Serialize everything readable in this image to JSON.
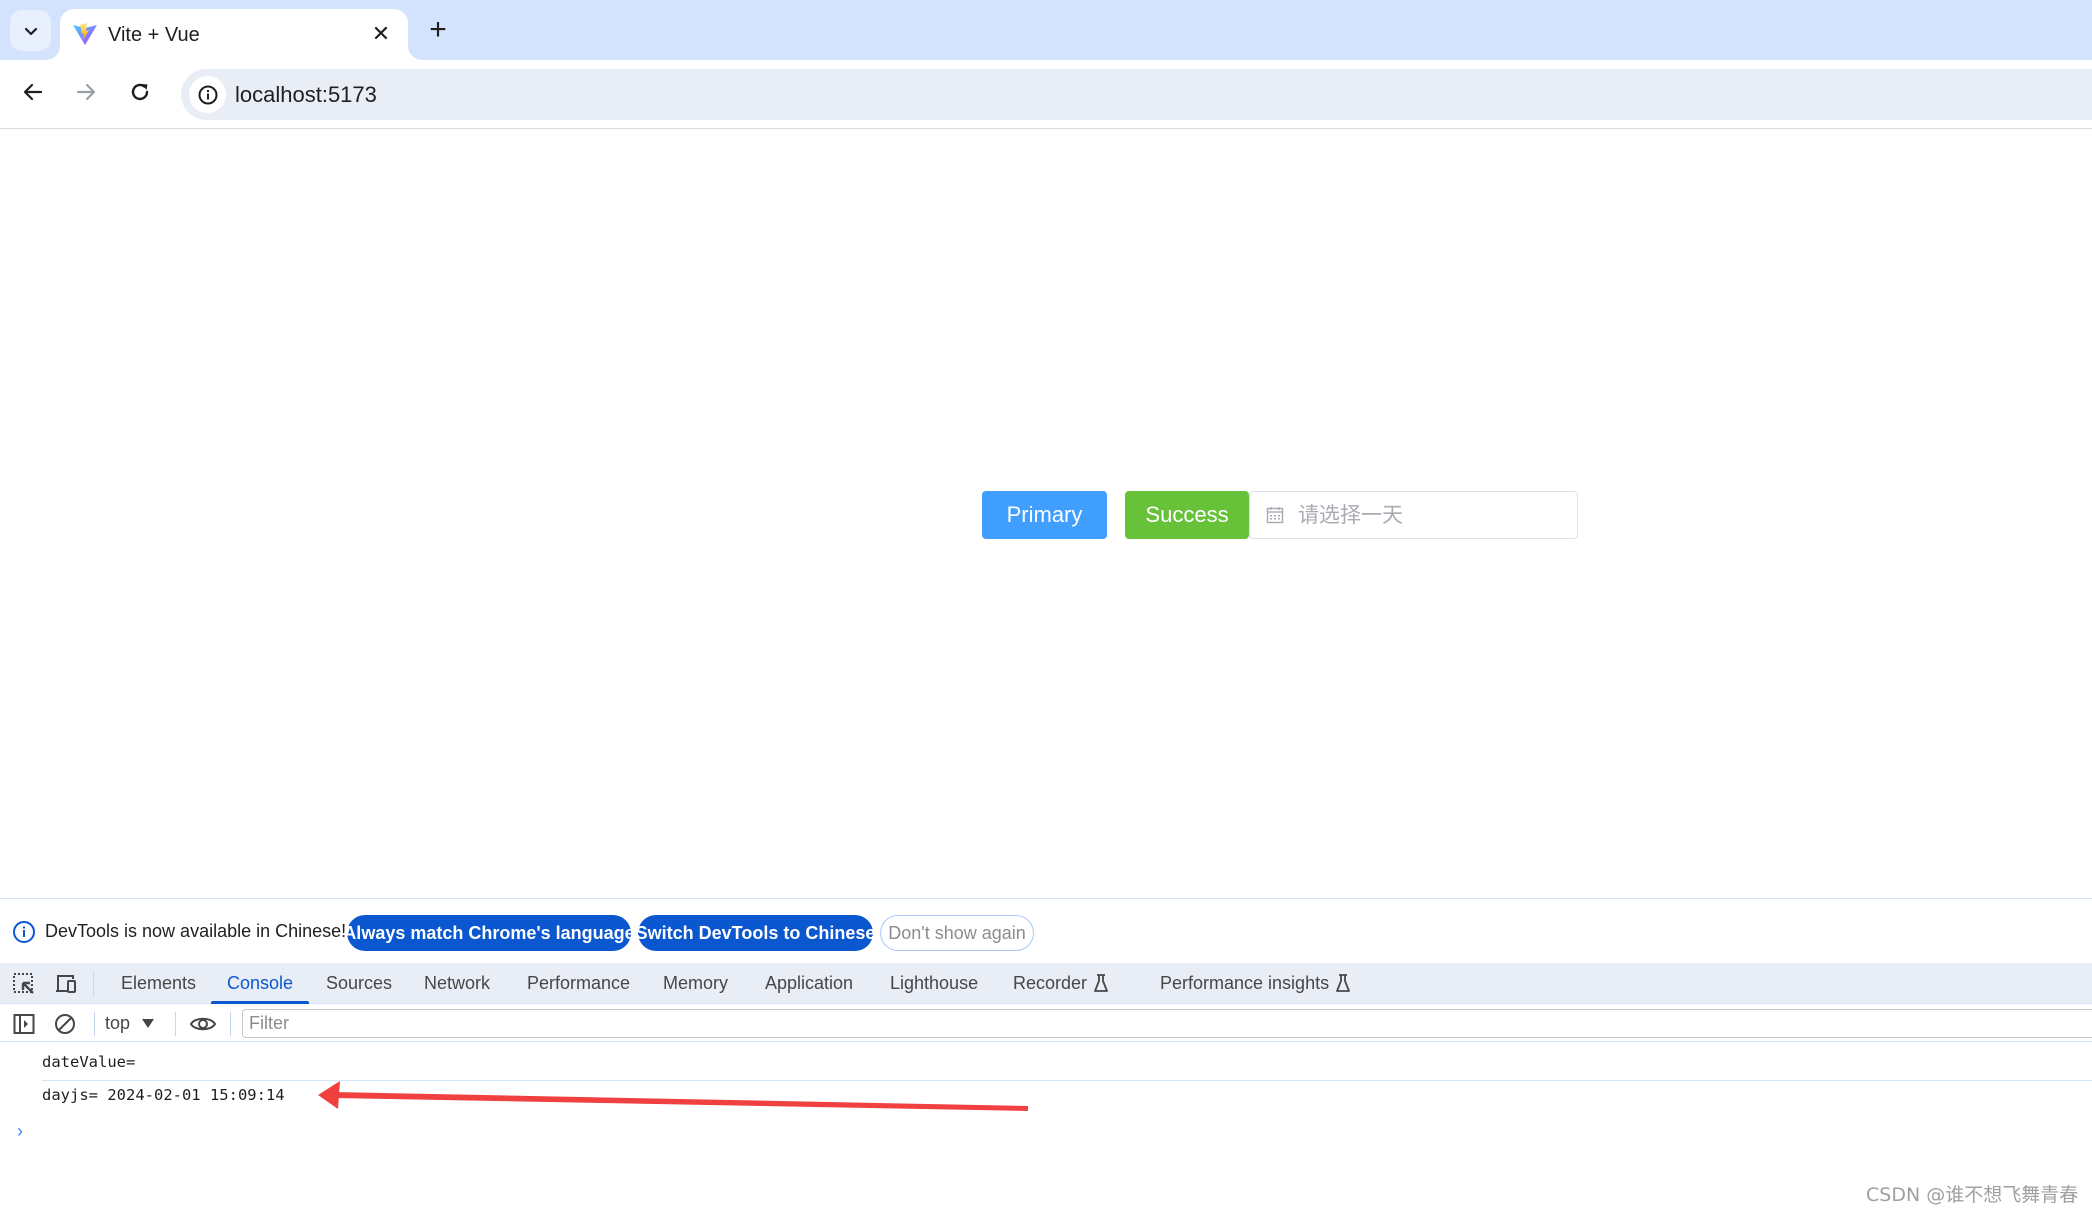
{
  "browser": {
    "tab": {
      "title": "Vite + Vue",
      "favicon": "vite-logo-icon"
    },
    "icons": {
      "tab_search": "chevron-down-icon",
      "tab_close": "close-icon",
      "new_tab": "plus-icon",
      "back": "arrow-left-icon",
      "forward": "arrow-right-icon",
      "reload": "reload-icon",
      "site_info": "info-icon"
    },
    "glyphs": {
      "tab_close": "✕",
      "new_tab": "+"
    },
    "url": "localhost:5173"
  },
  "page": {
    "primary_button": "Primary",
    "success_button": "Success",
    "date_picker": {
      "placeholder": "请选择一天",
      "value": "",
      "icon": "calendar-icon"
    },
    "colors": {
      "primary": "#409eff",
      "success": "#67c23a"
    }
  },
  "devtools": {
    "infobar": {
      "message": "DevTools is now available in Chinese!",
      "buttons": [
        "Always match Chrome's language",
        "Switch DevTools to Chinese",
        "Don't show again"
      ]
    },
    "tabs": [
      {
        "label": "Elements",
        "active": false
      },
      {
        "label": "Console",
        "active": true
      },
      {
        "label": "Sources",
        "active": false
      },
      {
        "label": "Network",
        "active": false
      },
      {
        "label": "Performance",
        "active": false
      },
      {
        "label": "Memory",
        "active": false
      },
      {
        "label": "Application",
        "active": false
      },
      {
        "label": "Lighthouse",
        "active": false
      },
      {
        "label": "Recorder",
        "active": false,
        "experimental": true
      },
      {
        "label": "Performance insights",
        "active": false,
        "experimental": true
      }
    ],
    "console_toolbar": {
      "context": "top",
      "filter_placeholder": "Filter",
      "filter_value": ""
    },
    "console_messages": [
      "dateValue=",
      "dayjs= 2024-02-01 15:09:14"
    ],
    "prompt": "›",
    "accent": "#0b57d0"
  },
  "annotation": {
    "type": "arrow",
    "color": "#f04040",
    "points_to": "dayjs= 2024-02-01 15:09:14"
  },
  "watermark": "CSDN @谁不想飞舞青春"
}
